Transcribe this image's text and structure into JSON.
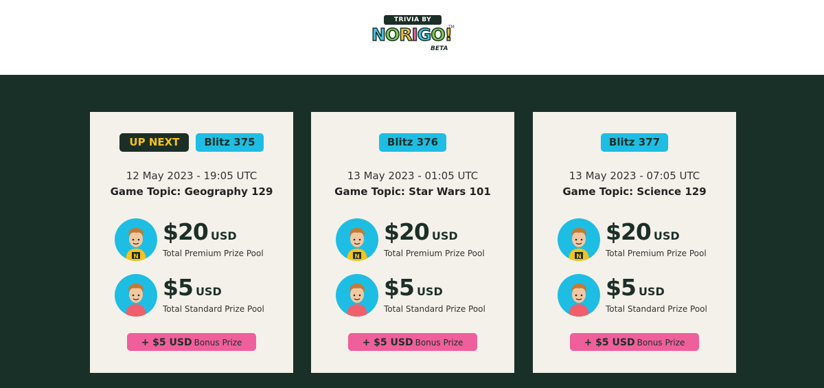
{
  "logo": {
    "top_text": "TRIVIA BY",
    "letters": [
      {
        "ch": "N",
        "color": "#42c3e8"
      },
      {
        "ch": "O",
        "color": "#7ccd4e"
      },
      {
        "ch": "R",
        "color": "#f0c23a"
      },
      {
        "ch": "I",
        "color": "#ef5f9c"
      },
      {
        "ch": "G",
        "color": "#42c3e8"
      },
      {
        "ch": "O",
        "color": "#7ccd4e"
      },
      {
        "ch": "!",
        "color": "#f0c23a"
      }
    ],
    "beta": "BETA",
    "tm": "TM"
  },
  "colors": {
    "header_bg": "#ffffff",
    "stage_bg": "#183028",
    "card_bg": "#f4f1ea",
    "blitz_badge": "#1ebde3",
    "upnext_badge_bg": "#1b2f27",
    "upnext_badge_text": "#f7c21a",
    "bonus_bg": "#ef5f9c"
  },
  "cards": [
    {
      "up_next": "UP NEXT",
      "blitz": "Blitz 375",
      "date": "12 May 2023 - 19:05 UTC",
      "topic": "Game Topic: Geography 129",
      "premium": {
        "amount": "$20",
        "currency": "USD",
        "label": "Total Premium Prize Pool",
        "icon": "premium-player-avatar-icon"
      },
      "standard": {
        "amount": "$5",
        "currency": "USD",
        "label": "Total Standard Prize Pool",
        "icon": "standard-player-avatar-icon"
      },
      "bonus": {
        "amount": "+ $5 USD",
        "label": "Bonus Prize"
      }
    },
    {
      "up_next": "",
      "blitz": "Blitz 376",
      "date": "13 May 2023 - 01:05 UTC",
      "topic": "Game Topic: Star Wars 101",
      "premium": {
        "amount": "$20",
        "currency": "USD",
        "label": "Total Premium Prize Pool",
        "icon": "premium-player-avatar-icon"
      },
      "standard": {
        "amount": "$5",
        "currency": "USD",
        "label": "Total Standard Prize Pool",
        "icon": "standard-player-avatar-icon"
      },
      "bonus": {
        "amount": "+ $5 USD",
        "label": "Bonus Prize"
      }
    },
    {
      "up_next": "",
      "blitz": "Blitz 377",
      "date": "13 May 2023 - 07:05 UTC",
      "topic": "Game Topic: Science 129",
      "premium": {
        "amount": "$20",
        "currency": "USD",
        "label": "Total Premium Prize Pool",
        "icon": "premium-player-avatar-icon"
      },
      "standard": {
        "amount": "$5",
        "currency": "USD",
        "label": "Total Standard Prize Pool",
        "icon": "standard-player-avatar-icon"
      },
      "bonus": {
        "amount": "+ $5 USD",
        "label": "Bonus Prize"
      }
    }
  ]
}
